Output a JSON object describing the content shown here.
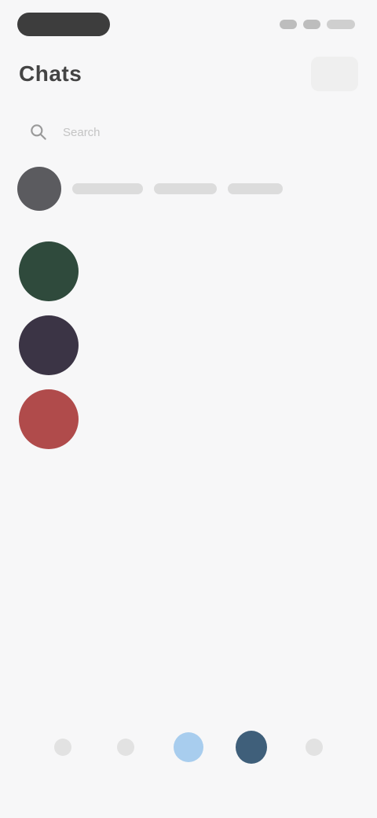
{
  "header": {
    "title": "Chats"
  },
  "search": {
    "placeholder": "Search"
  },
  "contacts": [
    {
      "label": ""
    },
    {
      "label": ""
    },
    {
      "label": ""
    }
  ],
  "chats": [
    {
      "name": "",
      "preview": "",
      "meta": "",
      "avatar_color": "#2f4a3c"
    },
    {
      "name": "",
      "preview": "",
      "meta": "",
      "avatar_color": "#3b3445"
    },
    {
      "name": "",
      "preview": "",
      "meta": "",
      "avatar_color": "#b04b4b"
    }
  ],
  "nav": {
    "items": [
      {
        "icon": "home-icon"
      },
      {
        "icon": "search-icon"
      },
      {
        "icon": "camera-icon"
      },
      {
        "icon": "profile-icon"
      },
      {
        "icon": "more-icon"
      }
    ]
  },
  "colors": {
    "accent_light": "#a8cdee",
    "accent_dark": "#3f5f7a",
    "background": "#f7f7f8"
  }
}
